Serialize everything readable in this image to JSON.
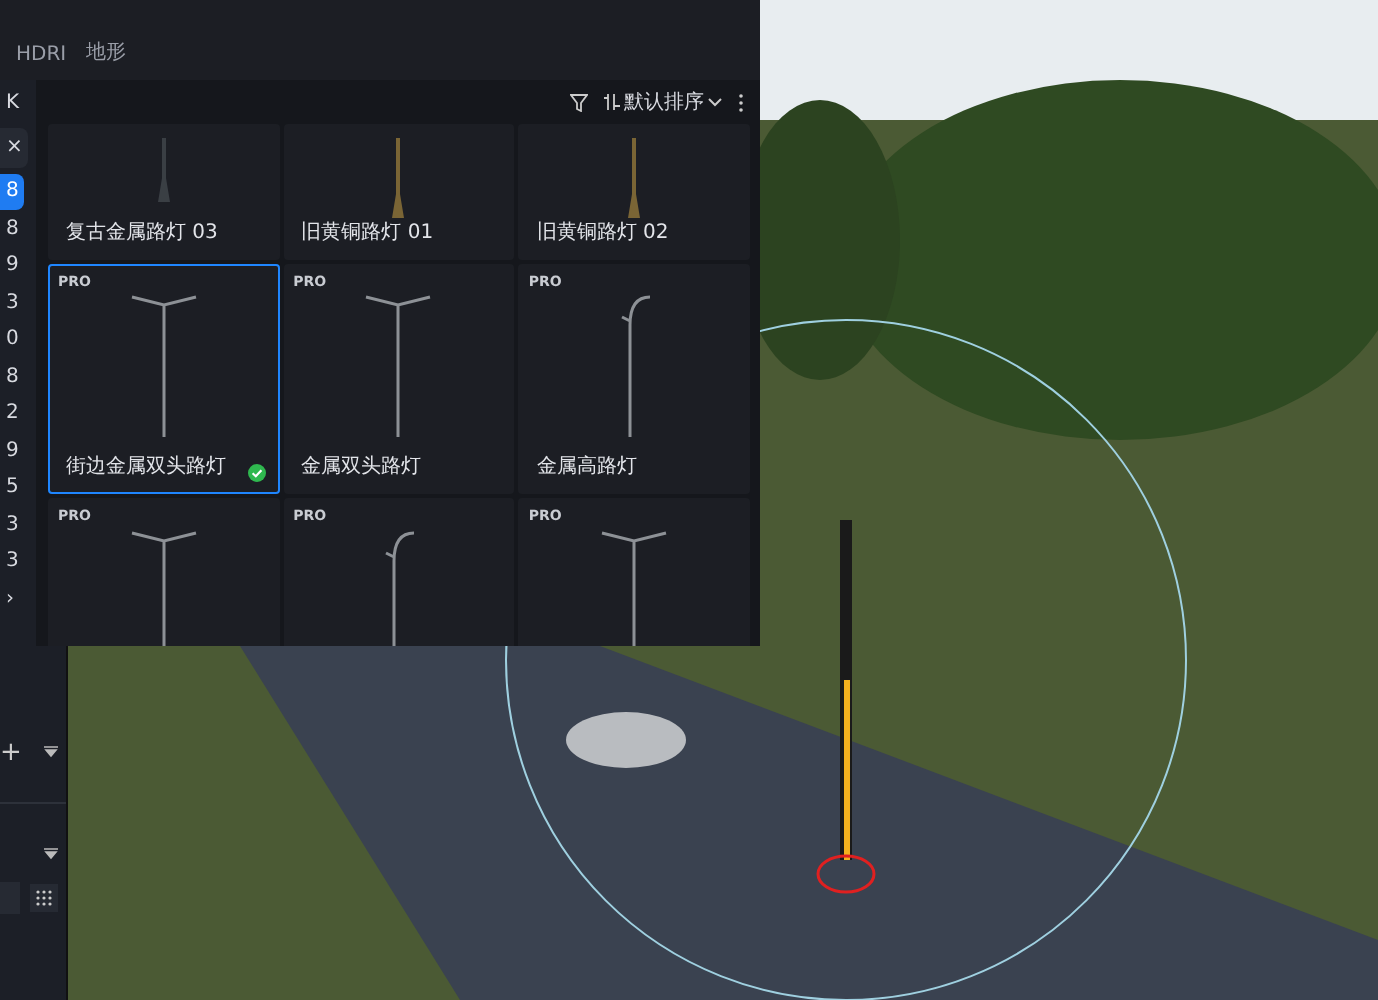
{
  "top_tabs": [
    {
      "label": "HDRI",
      "selected": false
    },
    {
      "label": "地形",
      "selected": false
    }
  ],
  "sidebar": {
    "items": [
      {
        "label": "K",
        "kind": "text",
        "selected": false
      },
      {
        "label": "×",
        "kind": "close",
        "selected": false
      },
      {
        "label": "8",
        "kind": "text",
        "selected": true
      },
      {
        "label": "8",
        "kind": "text",
        "selected": false
      },
      {
        "label": "9",
        "kind": "text",
        "selected": false
      },
      {
        "label": "3",
        "kind": "text",
        "selected": false
      },
      {
        "label": "0",
        "kind": "text",
        "selected": false
      },
      {
        "label": "8",
        "kind": "text",
        "selected": false
      },
      {
        "label": "2",
        "kind": "text",
        "selected": false
      },
      {
        "label": "9",
        "kind": "text",
        "selected": false
      },
      {
        "label": "5",
        "kind": "text",
        "selected": false
      },
      {
        "label": "3",
        "kind": "text",
        "selected": false
      },
      {
        "label": "3",
        "kind": "text",
        "selected": false
      },
      {
        "label": "›",
        "kind": "expand",
        "selected": false
      }
    ],
    "add_label": "+"
  },
  "panel": {
    "sort_label": "默认排序",
    "cards": [
      {
        "name": "复古金属路灯 03",
        "selected": false,
        "checked": false,
        "kind": "bollard"
      },
      {
        "name": "旧黄铜路灯 01",
        "selected": false,
        "checked": false,
        "kind": "brass"
      },
      {
        "name": "旧黄铜路灯 02",
        "selected": false,
        "checked": false,
        "kind": "brass"
      },
      {
        "badge": "PRO",
        "name": "街边金属双头路灯",
        "selected": true,
        "checked": true,
        "kind": "double"
      },
      {
        "badge": "PRO",
        "name": "金属双头路灯",
        "selected": false,
        "checked": false,
        "kind": "double"
      },
      {
        "badge": "PRO",
        "name": "金属高路灯",
        "selected": false,
        "checked": false,
        "kind": "curve"
      },
      {
        "badge": "PRO",
        "selected": false,
        "kind": "double"
      },
      {
        "badge": "PRO",
        "selected": false,
        "kind": "curve"
      },
      {
        "badge": "PRO",
        "selected": false,
        "kind": "double"
      }
    ]
  }
}
